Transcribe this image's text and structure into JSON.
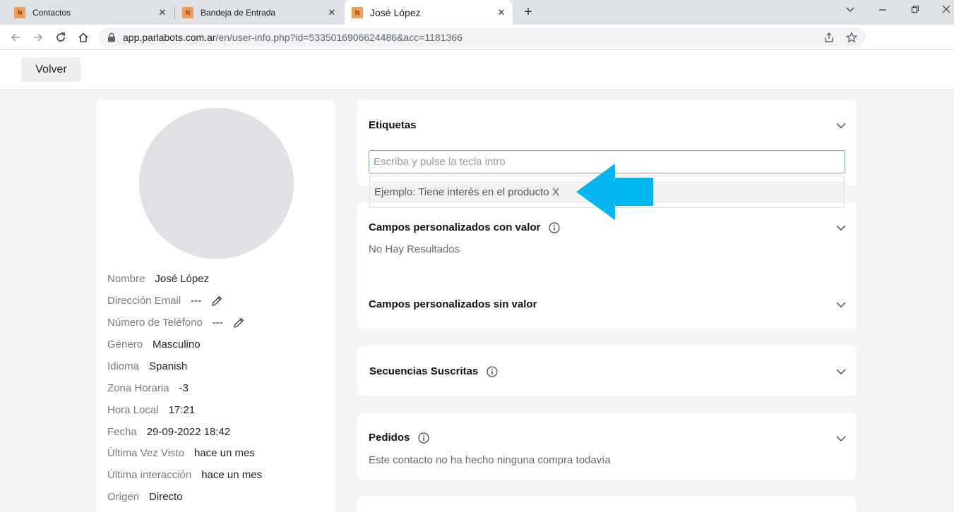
{
  "browser": {
    "tabs": [
      {
        "favicon": "N",
        "title": "Contactos"
      },
      {
        "favicon": "N",
        "title": "Bandeja de Entrada"
      },
      {
        "favicon": "N",
        "title": "José López"
      }
    ],
    "url_host": "app.parlabots.com.ar",
    "url_path": "/en/user-info.php?id=5335016906624486&acc=1181366"
  },
  "header": {
    "back_label": "Volver"
  },
  "profile": {
    "rows": [
      {
        "label": "Nombre",
        "value": "José López"
      },
      {
        "label": "Dirección Email",
        "value": "---"
      },
      {
        "label": "Número de Teléfono",
        "value": "---"
      },
      {
        "label": "Género",
        "value": "Masculino"
      },
      {
        "label": "Idioma",
        "value": "Spanish"
      },
      {
        "label": "Zona Horaria",
        "value": "-3"
      },
      {
        "label": "Hora Local",
        "value": "17:21"
      },
      {
        "label": "Fecha",
        "value": "29-09-2022 18:42"
      },
      {
        "label": "Última Vez Visto",
        "value": "hace un mes"
      },
      {
        "label": "Última interacción",
        "value": "hace un mes"
      },
      {
        "label": "Origen",
        "value": "Directo"
      }
    ]
  },
  "tags": {
    "title": "Etiquetas",
    "input_placeholder": "Escriba y pulse la tecla intro",
    "suggestion": "Ejemplo: Tiene interés en el producto X"
  },
  "custom_fields": {
    "with_value_title": "Campos personalizados con valor",
    "no_results": "No Hay Resultados",
    "without_value_title": "Campos personalizados sin valor"
  },
  "sequences": {
    "title": "Secuencias Suscritas"
  },
  "orders": {
    "title": "Pedidos",
    "empty_text": "Este contacto no ha hecho ninguna compra todavía"
  },
  "colors": {
    "arrow": "#00b5f0",
    "favicon": "#f39c55",
    "avatar": "#dfe1e5",
    "page_bg": "#f4f5f7"
  }
}
